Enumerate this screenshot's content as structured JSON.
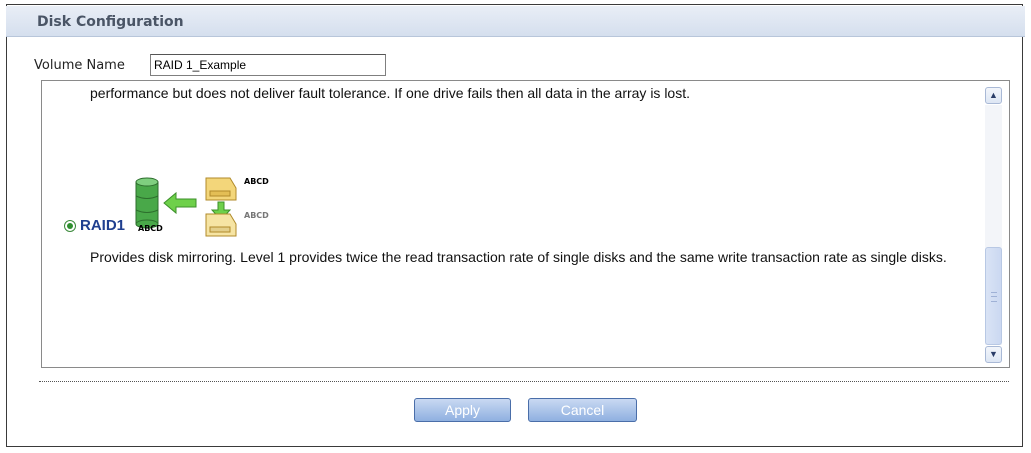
{
  "panel": {
    "title": "Disk Configuration"
  },
  "volume": {
    "label": "Volume Name",
    "value": "RAID 1_Example"
  },
  "content": {
    "previous_desc": "performance but does not deliver fault tolerance. If one drive fails then all data in the array is lost.",
    "raid1": {
      "label": "RAID1",
      "selected": true,
      "diagram_tags": [
        "ABCD",
        "ABCD",
        "ABCD"
      ],
      "description": "Provides disk mirroring. Level 1 provides twice the read transaction rate of single disks and the same write transaction rate as single disks."
    }
  },
  "buttons": {
    "apply": "Apply",
    "cancel": "Cancel"
  },
  "colors": {
    "accent": "#1f3f8f",
    "button": "#8fb0e0",
    "titlebar": "#d5dfee"
  }
}
